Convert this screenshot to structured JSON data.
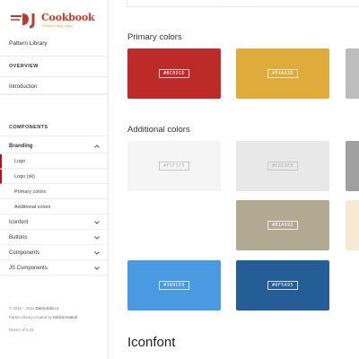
{
  "sidebar": {
    "logo": {
      "wordmark": "Cookbook",
      "tagline": "Užitečné rady a tipy"
    },
    "site_title": "Pattern Library",
    "overview_heading": "OVERVIEW",
    "introduction": "Introduction",
    "components_heading": "COMPONENTS",
    "nav": [
      {
        "label": "Branding",
        "expanded": true
      },
      {
        "label": "Logo"
      },
      {
        "label": "Logo (sk)"
      },
      {
        "label": "Primary colors"
      },
      {
        "label": "Additional colors"
      },
      {
        "label": "Iconfont"
      },
      {
        "label": "Buttons"
      },
      {
        "label": "Components"
      },
      {
        "label": "JS Components"
      }
    ],
    "footer": {
      "copyright_prefix": "© 2016 – 2022",
      "copyright_site": "DámeJídlo.cz",
      "created_prefix": "Pattern library created by",
      "created_author": "Michal Svatoš",
      "return": "Return of 3.16"
    }
  },
  "main": {
    "top_strip_text": "· · · · · · · · · ·",
    "primary_heading": "Primary colors",
    "additional_heading": "Additional colors",
    "iconfont_heading": "Iconfont",
    "primary_colors": [
      {
        "hex": "#BC0D1D",
        "color": "#bc2b28"
      },
      {
        "hex": "#E4AA3D",
        "color": "#dfab3a"
      },
      {
        "hex": "",
        "color": "#bdbdbd"
      }
    ],
    "additional_colors": [
      {
        "hex": "#F5F5F5",
        "color": "#f5f5f5"
      },
      {
        "hex": "#E8E8E8",
        "color": "#e8e8e8"
      },
      {
        "hex": "",
        "color": "#a0a0a0"
      },
      {
        "hex": "#B1A992",
        "color": "#b1a992"
      },
      {
        "hex": "",
        "color": "#f6ead2"
      },
      {
        "hex": "#389CE0",
        "color": "#4a9ae1"
      },
      {
        "hex": "#0F5A95",
        "color": "#255e97"
      }
    ]
  }
}
